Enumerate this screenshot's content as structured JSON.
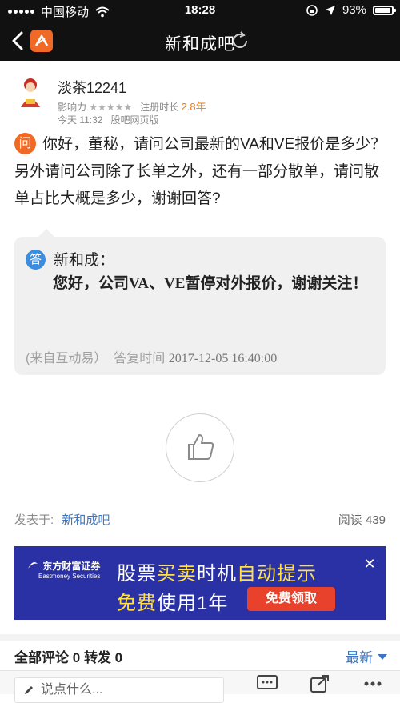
{
  "status_bar": {
    "carrier": "中国移动",
    "time": "18:28",
    "battery": "93%"
  },
  "nav": {
    "title": "新和成吧"
  },
  "post": {
    "username": "淡茶12241",
    "influence_label": "影响力",
    "stars": "★★★★★",
    "reg_label": "注册时长",
    "reg_value": "2.8年",
    "date": "今天 11:32",
    "source": "股吧网页版",
    "q_badge": "问",
    "question": "你好，董秘，请问公司最新的VA和VE报价是多少？另外请问公司除了长单之外，还有一部分散单，请问散单占比大概是多少，谢谢回答?"
  },
  "answer": {
    "badge": "答",
    "name": "新和成：",
    "text": "您好，公司VA、VE暂停对外报价，谢谢关注！",
    "source": "(来自互动易）",
    "reply_label": "答复时间",
    "time": "2017-12-05 16:40:00"
  },
  "footer_meta": {
    "posted_in_label": "发表于:",
    "bar_name": "新和成吧",
    "read_label": "阅读",
    "read_count": "439"
  },
  "ad": {
    "brand": "东方财富证券",
    "brand_en": "Eastmoney Securities",
    "l1a": "股票",
    "l1b": "买卖",
    "l1c": "时机",
    "l1d": "自动提示",
    "l2a": "免费",
    "l2b": "使用1年",
    "cta": "免费领取",
    "close": "✕"
  },
  "comments": {
    "all_label": "全部评论",
    "all_count": "0",
    "forward_label": "转发",
    "forward_count": "0",
    "sort_label": "最新"
  },
  "bottom": {
    "input_placeholder": "说点什么..."
  },
  "colors": {
    "accent_orange": "#f06a26",
    "link_blue": "#3a76c4",
    "answer_blue": "#3b8de0",
    "ad_bg": "#2a31a4",
    "ad_yellow": "#ffe04a",
    "ad_cta_red": "#e8412c"
  }
}
